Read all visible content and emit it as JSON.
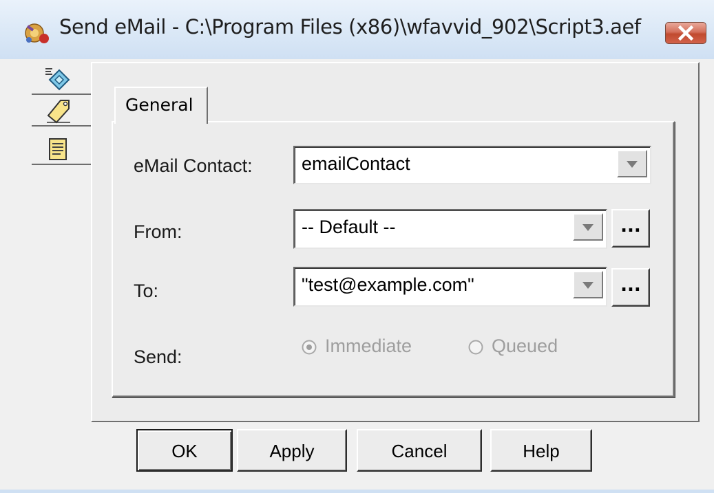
{
  "window": {
    "title": "Send eMail - C:\\Program Files (x86)\\wfavvid_902\\Script3.aef"
  },
  "side_tabs": [
    {
      "icon": "properties-icon"
    },
    {
      "icon": "tag-icon"
    },
    {
      "icon": "notes-icon"
    }
  ],
  "tab": {
    "label": "General"
  },
  "form": {
    "email_contact": {
      "label": "eMail Contact:",
      "value": "emailContact"
    },
    "from": {
      "label": "From:",
      "value": "-- Default --",
      "browse_label": "..."
    },
    "to": {
      "label": "To:",
      "value": "\"test@example.com\"",
      "browse_label": "..."
    },
    "send": {
      "label": "Send:",
      "options": [
        {
          "label": "Immediate",
          "selected": true
        },
        {
          "label": "Queued",
          "selected": false
        }
      ]
    }
  },
  "buttons": {
    "ok": "OK",
    "apply": "Apply",
    "cancel": "Cancel",
    "help": "Help"
  },
  "colors": {
    "titlebar": "#dce9f7",
    "close_button": "#c04a2f",
    "disabled_text": "#9e9e9e"
  }
}
